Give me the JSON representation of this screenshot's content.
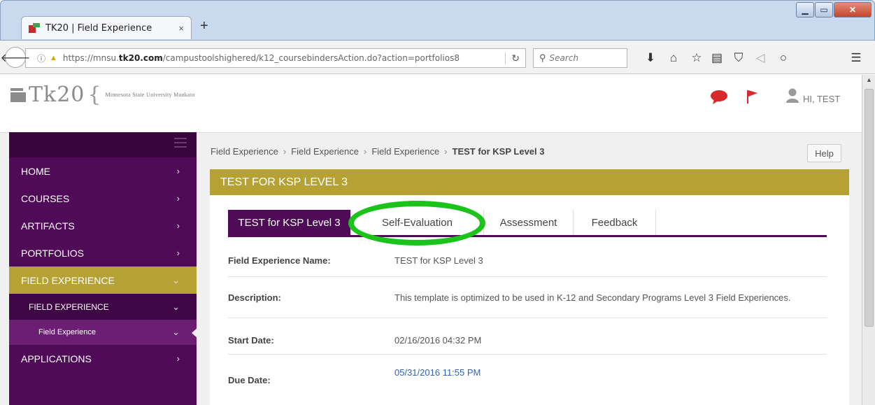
{
  "browser": {
    "tab_title": "TK20 | Field Experience",
    "tab_close": "×",
    "new_tab": "+",
    "url_plain_before": "https://mnsu.",
    "url_domain": "tk20.com",
    "url_plain_after": "/campustoolshighered/k12_coursebindersAction.do?action=portfolios8",
    "search_placeholder": "Search",
    "window_controls": {
      "minimize": "▁",
      "maximize": "▭",
      "close": "✕"
    },
    "toolbar_icons": [
      "download-icon",
      "home-icon",
      "bookmark-star-icon",
      "reading-list-icon",
      "pocket-icon",
      "send-icon",
      "chat-icon",
      "menu-icon"
    ]
  },
  "header": {
    "logo_text": "Tk20",
    "logo_brace": "{",
    "university": "Minnesota State University Mankato",
    "greeting": "HI, TEST",
    "colors": {
      "chat": "#d8282b",
      "flag": "#d8282b",
      "user": "#9a9a9a"
    }
  },
  "sidebar": {
    "items": [
      {
        "label": "HOME",
        "chevron": "›"
      },
      {
        "label": "COURSES",
        "chevron": "›"
      },
      {
        "label": "ARTIFACTS",
        "chevron": "›"
      },
      {
        "label": "PORTFOLIOS",
        "chevron": "›"
      },
      {
        "label": "FIELD EXPERIENCE",
        "chevron": "⌄"
      },
      {
        "label": "FIELD EXPERIENCE",
        "chevron": "⌄"
      },
      {
        "label": "Field Experience",
        "chevron": "⌄"
      },
      {
        "label": "APPLICATIONS",
        "chevron": "›"
      }
    ]
  },
  "breadcrumb": {
    "items": [
      "Field Experience",
      "Field Experience",
      "Field Experience"
    ],
    "current": "TEST for KSP Level 3",
    "separator": "›"
  },
  "help_label": "Help",
  "panel": {
    "title": "TEST FOR KSP LEVEL 3",
    "tabs": [
      "TEST for KSP Level 3",
      "Self-Evaluation",
      "Assessment",
      "Feedback"
    ],
    "fields": [
      {
        "label": "Field Experience Name:",
        "value": "TEST for KSP Level 3"
      },
      {
        "label": "Description:",
        "value": "This template is optimized to be used in K-12 and Secondary Programs Level 3 Field Experiences."
      },
      {
        "label": "Start Date:",
        "value": "02/16/2016 04:32 PM"
      },
      {
        "label": "Due Date:",
        "value": "05/31/2016 11:55 PM"
      }
    ]
  },
  "colors": {
    "purple": "#4f0b57",
    "gold": "#b6a234",
    "highlight": "#1bc31b",
    "link": "#2f63b3"
  }
}
